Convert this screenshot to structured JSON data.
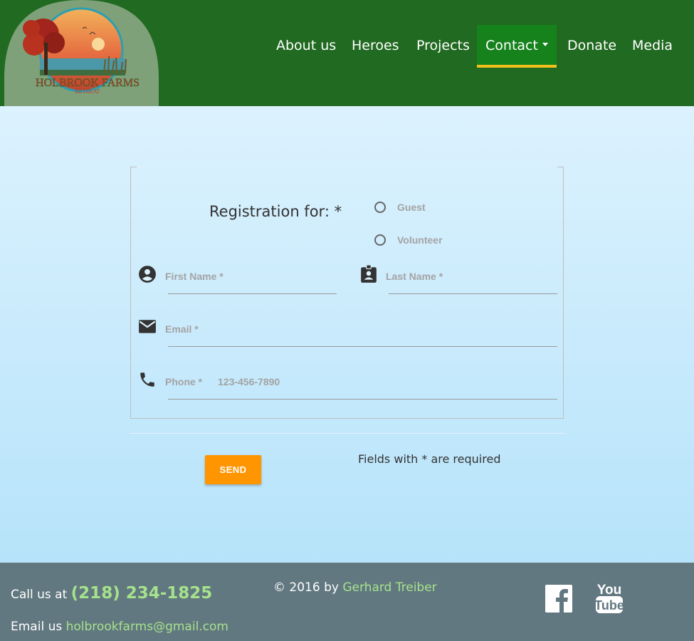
{
  "header": {
    "logo_text": "HOLBROOK FARMS",
    "logo_subtext": "RETREAT",
    "nav": [
      {
        "label": "About us"
      },
      {
        "label": "Heroes"
      },
      {
        "label": "Projects"
      },
      {
        "label": "Contact",
        "active": true,
        "has_dropdown": true
      },
      {
        "label": "Donate"
      },
      {
        "label": "Media"
      }
    ]
  },
  "form": {
    "registration_label": "Registration for: *",
    "radio_options": [
      "Guest",
      "Volunteer"
    ],
    "first_name": {
      "placeholder": "First Name *",
      "icon": "account-circle-icon"
    },
    "last_name": {
      "placeholder": "Last Name *",
      "icon": "badge-icon"
    },
    "email": {
      "placeholder": "Email *",
      "icon": "mail-icon"
    },
    "phone": {
      "placeholder": "Phone *",
      "hint": "123-456-7890",
      "icon": "phone-icon"
    },
    "send_label": "SEND",
    "required_note": "Fields with * are required"
  },
  "footer": {
    "call_prefix": "Call us at",
    "phone": "(218) 234-1825",
    "email_prefix": "Email us",
    "email": "holbrookfarms@gmail.com",
    "copyright_prefix": "© 2016 by",
    "author": "Gerhard Treiber",
    "social": [
      "facebook-icon",
      "youtube-icon"
    ],
    "youtube_you": "You",
    "youtube_tube": "Tube"
  },
  "colors": {
    "header_bg": "#216a21",
    "nav_active_bg": "#16821c",
    "nav_active_underline": "#f2c01b",
    "send_button": "#ff9500",
    "footer_bg": "#627880",
    "footer_link": "#a5e28c"
  }
}
